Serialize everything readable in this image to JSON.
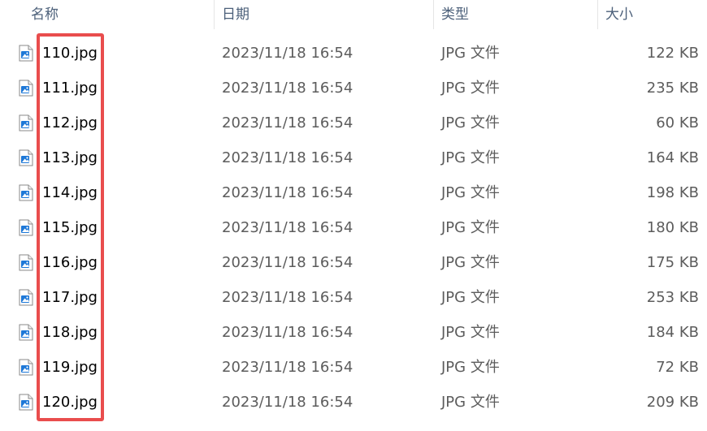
{
  "columns": {
    "name": "名称",
    "date": "日期",
    "type": "类型",
    "size": "大小"
  },
  "sort_indicator": "^",
  "icon": "jpg-file-icon",
  "files": [
    {
      "name": "110.jpg",
      "date": "2023/11/18 16:54",
      "type": "JPG 文件",
      "size": "122 KB"
    },
    {
      "name": "111.jpg",
      "date": "2023/11/18 16:54",
      "type": "JPG 文件",
      "size": "235 KB"
    },
    {
      "name": "112.jpg",
      "date": "2023/11/18 16:54",
      "type": "JPG 文件",
      "size": "60 KB"
    },
    {
      "name": "113.jpg",
      "date": "2023/11/18 16:54",
      "type": "JPG 文件",
      "size": "164 KB"
    },
    {
      "name": "114.jpg",
      "date": "2023/11/18 16:54",
      "type": "JPG 文件",
      "size": "198 KB"
    },
    {
      "name": "115.jpg",
      "date": "2023/11/18 16:54",
      "type": "JPG 文件",
      "size": "180 KB"
    },
    {
      "name": "116.jpg",
      "date": "2023/11/18 16:54",
      "type": "JPG 文件",
      "size": "175 KB"
    },
    {
      "name": "117.jpg",
      "date": "2023/11/18 16:54",
      "type": "JPG 文件",
      "size": "253 KB"
    },
    {
      "name": "118.jpg",
      "date": "2023/11/18 16:54",
      "type": "JPG 文件",
      "size": "184 KB"
    },
    {
      "name": "119.jpg",
      "date": "2023/11/18 16:54",
      "type": "JPG 文件",
      "size": "72 KB"
    },
    {
      "name": "120.jpg",
      "date": "2023/11/18 16:54",
      "type": "JPG 文件",
      "size": "209 KB"
    }
  ],
  "colors": {
    "highlight": "#e94d4d",
    "header_text": "#4c607a",
    "icon_blue": "#1e78d7"
  }
}
